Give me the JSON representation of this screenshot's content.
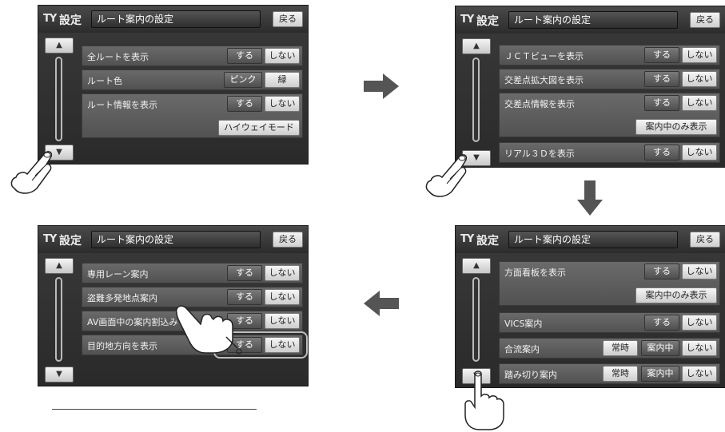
{
  "title_icon": "TY",
  "title_label": "設定",
  "title_box": "ルート案内の設定",
  "back_label": "戻る",
  "screen1": {
    "rows": [
      {
        "label": "全ルートを表示",
        "opts": [
          "する",
          "しない"
        ],
        "selected": 0
      },
      {
        "label": "ルート色",
        "opts": [
          "ピンク",
          "緑"
        ],
        "selected": 0
      },
      {
        "label": "ルート情報を表示",
        "opts": [
          "する",
          "しない"
        ],
        "selected": 0
      },
      {
        "label": "",
        "opts": [
          "ハイウェイモード"
        ],
        "selected": 0
      }
    ]
  },
  "screen2": {
    "rows": [
      {
        "label": "ＪＣＴビューを表示",
        "opts": [
          "する",
          "しない"
        ],
        "selected": 0
      },
      {
        "label": "交差点拡大図を表示",
        "opts": [
          "する",
          "しない"
        ],
        "selected": 0
      },
      {
        "label": "交差点情報を表示",
        "opts": [
          "する",
          "しない"
        ],
        "selected": 0
      },
      {
        "label": "",
        "opts": [
          "案内中のみ表示"
        ],
        "selected": -1
      },
      {
        "label": "リアル３Ｄを表示",
        "opts": [
          "する",
          "しない"
        ],
        "selected": 0
      }
    ]
  },
  "screen3": {
    "rows": [
      {
        "label": "方面看板を表示",
        "opts": [
          "する",
          "しない"
        ],
        "selected": 0
      },
      {
        "label": "",
        "opts": [
          "案内中のみ表示"
        ],
        "selected": -1
      },
      {
        "label": "VICS案内",
        "opts": [
          "する",
          "しない"
        ],
        "selected": 0
      },
      {
        "label": "合流案内",
        "opts": [
          "常時",
          "案内中",
          "しない"
        ],
        "selected": 1
      },
      {
        "label": "踏み切り案内",
        "opts": [
          "常時",
          "案内中",
          "しない"
        ],
        "selected": 1
      }
    ]
  },
  "screen4": {
    "rows": [
      {
        "label": "専用レーン案内",
        "opts": [
          "する",
          "しない"
        ],
        "selected": 0
      },
      {
        "label": "盗難多発地点案内",
        "opts": [
          "する",
          "しない"
        ],
        "selected": 0
      },
      {
        "label": "AV画面中の案内割込み",
        "opts": [
          "する",
          "しない"
        ],
        "selected": 0
      },
      {
        "label": "目的地方向を表示",
        "opts": [
          "する",
          "しない"
        ],
        "selected": 0
      }
    ]
  },
  "scroll_up_glyph": "▲",
  "scroll_down_glyph": "▼"
}
